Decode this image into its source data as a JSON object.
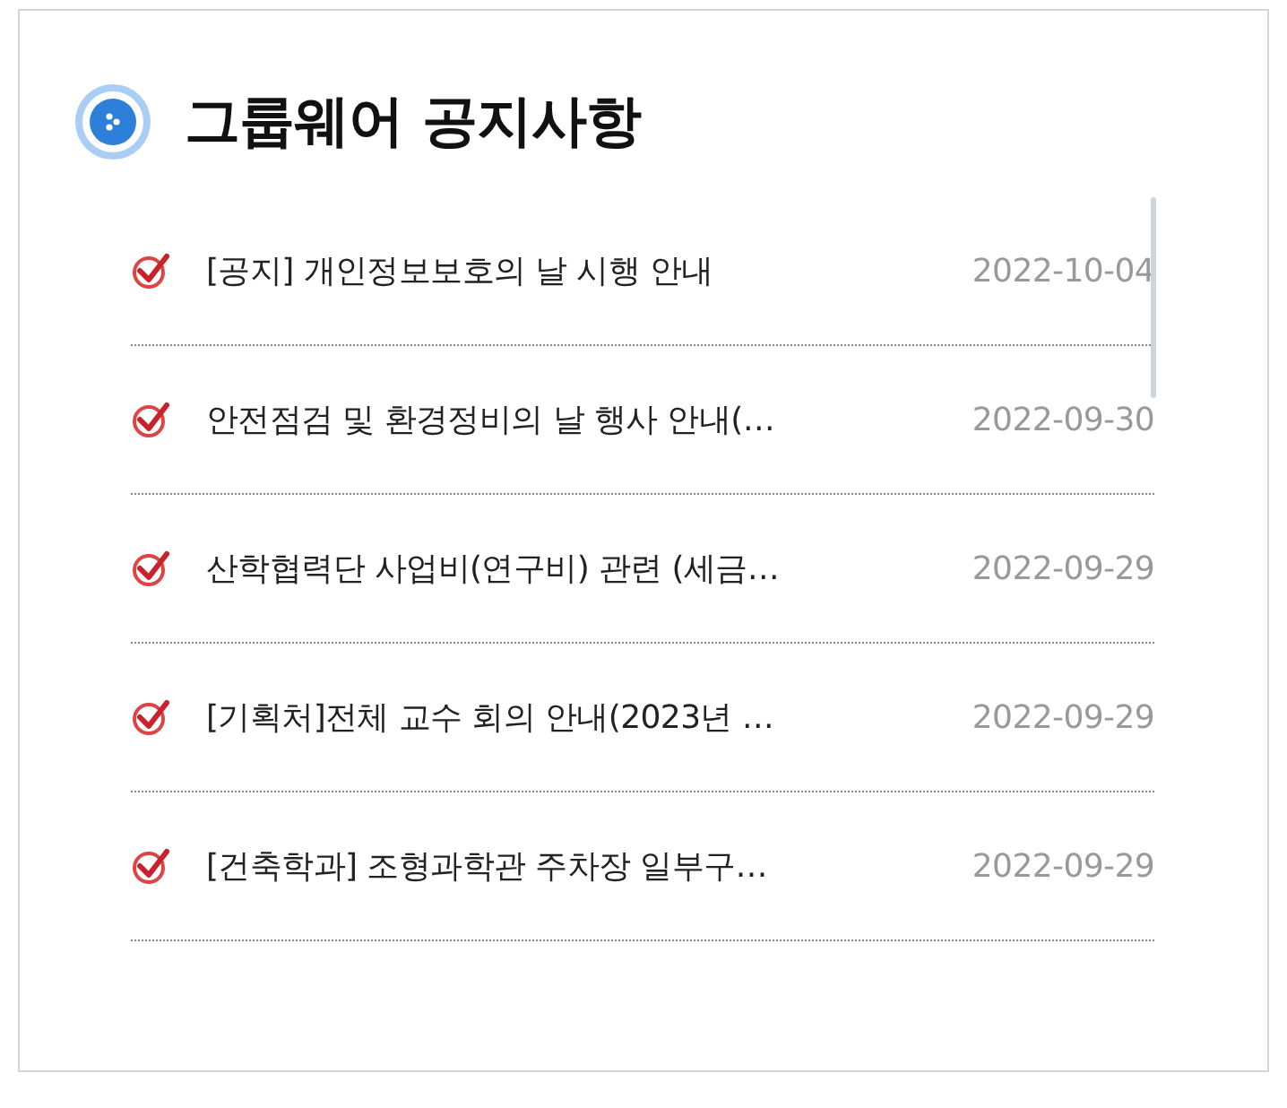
{
  "panel": {
    "title": "그룹웨어 공지사항"
  },
  "notices": [
    {
      "title": "[공지] 개인정보보호의 날 시행 안내",
      "date": "2022-10-04"
    },
    {
      "title": "안전점검 및 환경정비의 날 행사 안내(…",
      "date": "2022-09-30"
    },
    {
      "title": "산학협력단 사업비(연구비) 관련 (세금…",
      "date": "2022-09-29"
    },
    {
      "title": "[기획처]전체 교수 회의 안내(2023년 …",
      "date": "2022-09-29"
    },
    {
      "title": "[건축학과] 조형과학관 주차장 일부구…",
      "date": "2022-09-29"
    }
  ]
}
